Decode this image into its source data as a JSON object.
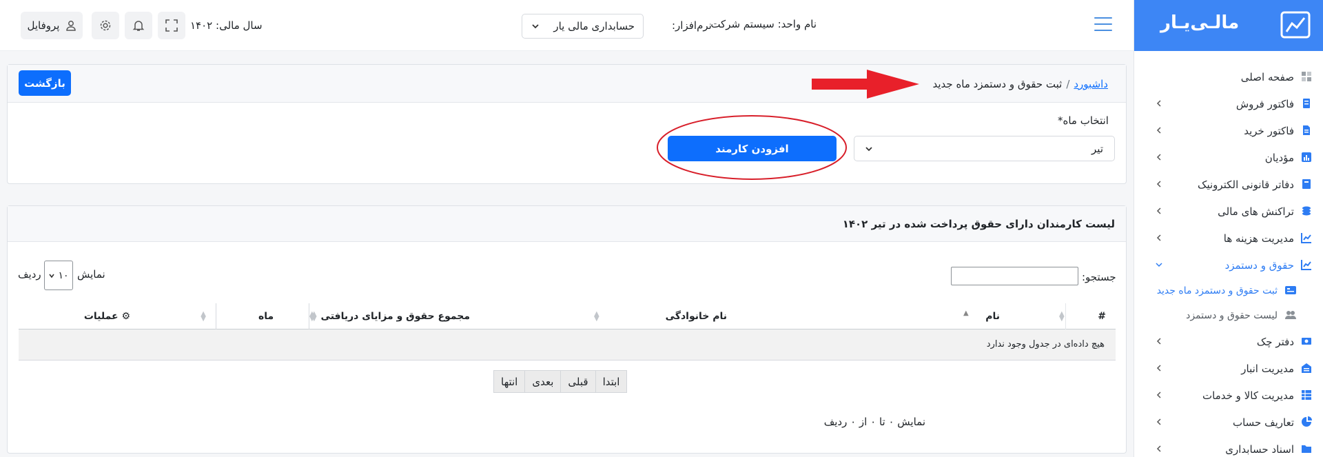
{
  "header": {
    "unit_label": "نام واحد:",
    "unit_value": "سیستم شرکت",
    "software_label": "نرم‌افزار:",
    "software_value": "حسابداری مالی یار",
    "year_label": "سال مالی:",
    "year_value": "۱۴۰۲",
    "profile_label": "پروفایل"
  },
  "logo": {
    "text": "مالـی‌یـار"
  },
  "breadcrumb": {
    "home": "داشبورد",
    "separator": "/",
    "current": "ثبت حقوق و دستمزد ماه جدید"
  },
  "back_button": "بازگشت",
  "form": {
    "month_label": "انتخاب ماه*",
    "month_value": "تیر",
    "add_employee_button": "افزودن کارمند"
  },
  "list": {
    "title": "لیست کارمندان دارای حقوق پرداخت شده در تیر ۱۴۰۲",
    "search_label": "جستجو:",
    "show_label": "نمایش",
    "page_length": "۱۰",
    "rows_label": "ردیف",
    "columns": [
      "#",
      "نام",
      "نام خانوادگی",
      "مجموع حقوق و مزایای دریافتی",
      "ماه",
      "عملیات"
    ],
    "empty_message": "هیچ داده‌ای در جدول وجود ندارد",
    "pagination": [
      "ابتدا",
      "قبلی",
      "بعدی",
      "انتها"
    ],
    "info": "نمایش ۰ تا ۰ از ۰ ردیف"
  },
  "sidebar": {
    "items": [
      {
        "label": "صفحه اصلی",
        "icon": "grid-icon"
      },
      {
        "label": "فاکتور فروش",
        "icon": "invoice-icon"
      },
      {
        "label": "فاکتور خرید",
        "icon": "document-icon"
      },
      {
        "label": "مؤدیان",
        "icon": "chart-box-icon"
      },
      {
        "label": "دفاتر قانونی الکترونیک",
        "icon": "book-icon"
      },
      {
        "label": "تراکنش های مالی",
        "icon": "coins-icon"
      },
      {
        "label": "مدیریت هزینه ها",
        "icon": "trend-icon"
      },
      {
        "label": "حقوق و دستمزد",
        "icon": "trend-icon"
      },
      {
        "label": "دفتر چک",
        "icon": "cheque-icon"
      },
      {
        "label": "مدیریت انبار",
        "icon": "warehouse-icon"
      },
      {
        "label": "مدیریت کالا و خدمات",
        "icon": "table-icon"
      },
      {
        "label": "تعاریف حساب",
        "icon": "pie-icon"
      },
      {
        "label": "اسناد حسابداری",
        "icon": "folder-icon"
      }
    ],
    "subitems": [
      {
        "label": "ثبت حقوق و دستمزد ماه جدید",
        "icon": "id-card-icon"
      },
      {
        "label": "لیست حقوق و دستمزد",
        "icon": "users-icon"
      }
    ]
  },
  "colors": {
    "primary": "#0d6efd",
    "logo_bg": "#3d86f5",
    "annotation_red": "#e8202a"
  }
}
